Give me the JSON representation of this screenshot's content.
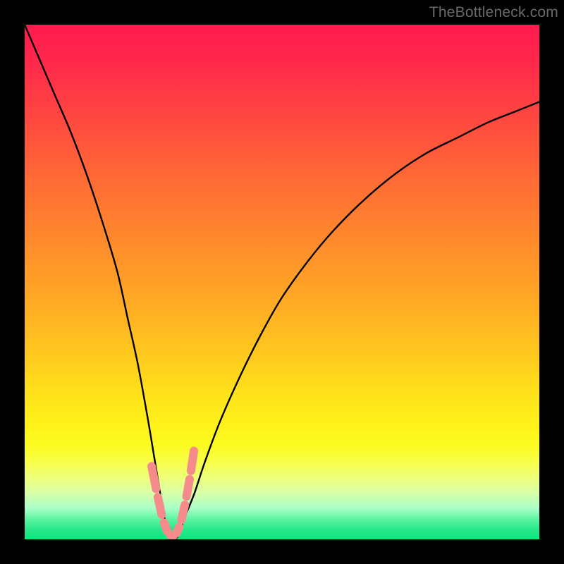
{
  "watermark": "TheBottleneck.com",
  "chart_data": {
    "type": "line",
    "title": "",
    "xlabel": "",
    "ylabel": "",
    "xlim": [
      0,
      100
    ],
    "ylim": [
      0,
      100
    ],
    "grid": false,
    "legend": false,
    "description": "Bottleneck / mismatch curve. X axis: component balance ratio (arbitrary 0–100). Y axis: bottleneck percentage (0 at bottom = optimal, 100 at top = severe). The curve drops steeply from top-left to a minimum near x≈28 then rises toward the right.",
    "series": [
      {
        "name": "bottleneck_curve",
        "x": [
          0,
          3,
          6,
          9,
          12,
          15,
          18,
          20,
          22,
          24,
          25,
          26,
          27,
          28,
          29,
          30,
          31,
          33,
          35,
          38,
          42,
          46,
          50,
          55,
          60,
          66,
          72,
          78,
          84,
          90,
          95,
          100
        ],
        "y": [
          100,
          93,
          86,
          79,
          71,
          62,
          52,
          43,
          34,
          23,
          17,
          11,
          5,
          1,
          0,
          1,
          4,
          9,
          15,
          23,
          32,
          40,
          47,
          54,
          60,
          66,
          71,
          75,
          78,
          81,
          83,
          85
        ]
      }
    ],
    "optimal_markers": {
      "description": "Salmon dashed segment markers near the minimum indicating recommended operating range",
      "points_x": [
        24.5,
        25.7,
        26.8,
        28.0,
        29.2,
        30.3,
        31.3,
        32.2,
        33.0
      ],
      "points_y": [
        15.0,
        9.0,
        4.0,
        0.8,
        0.6,
        3.0,
        7.5,
        12.5,
        18.0
      ]
    },
    "background_gradient": {
      "top_color": "#ff1a4f",
      "bottom_color": "#10e480",
      "meaning": "red = high bottleneck, green = balanced"
    }
  }
}
